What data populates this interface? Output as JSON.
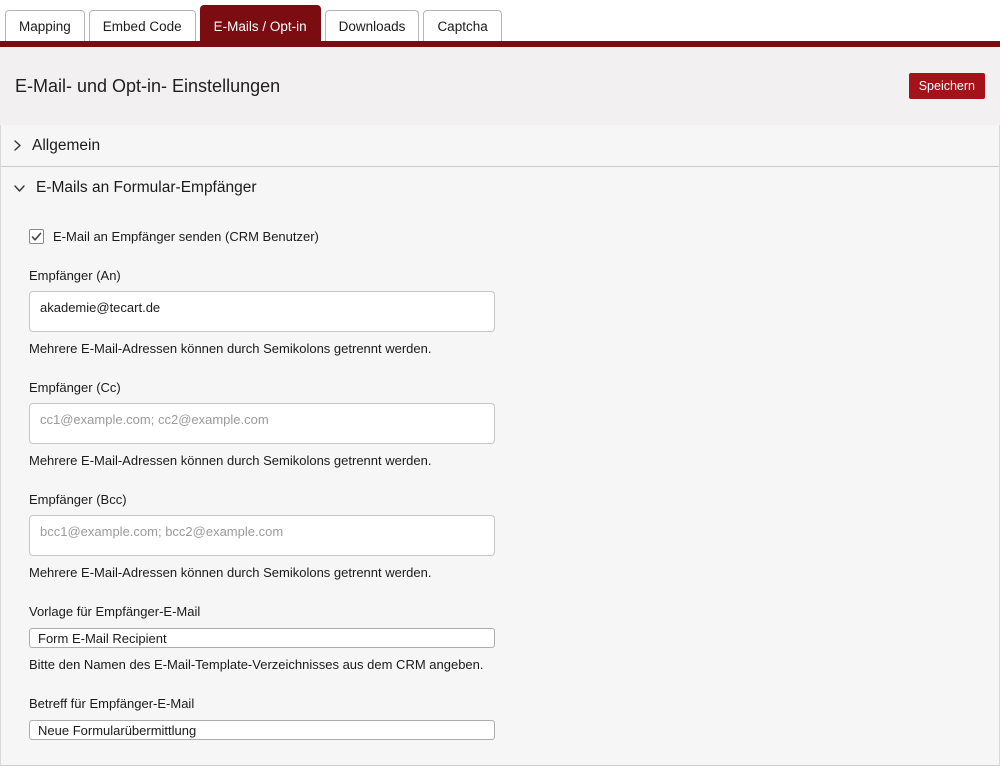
{
  "colors": {
    "accent_maroon": "#7b0d12",
    "save_button_red": "#a5131a",
    "header_band_bg": "#f2f0f0",
    "panel_bg": "#f7f6f6"
  },
  "tabs": [
    {
      "label": "Mapping",
      "active": false
    },
    {
      "label": "Embed Code",
      "active": false
    },
    {
      "label": "E-Mails / Opt-in",
      "active": true
    },
    {
      "label": "Downloads",
      "active": false
    },
    {
      "label": "Captcha",
      "active": false
    }
  ],
  "header": {
    "title": "E-Mail- und Opt-in- Einstellungen",
    "save_label": "Speichern"
  },
  "sections": [
    {
      "label": "Allgemein",
      "state": "collapsed",
      "icon": "chevron-right-icon"
    },
    {
      "label": "E-Mails an Formular-Empfänger",
      "state": "expanded",
      "icon": "chevron-down-icon"
    }
  ],
  "form": {
    "checkbox": {
      "checked": true,
      "label": "E-Mail an Empfänger senden (CRM Benutzer)",
      "icon": "checkmark-icon"
    },
    "fields": [
      {
        "id": "empfaenger-an",
        "label": "Empfänger (An)",
        "value": "akademie@tecart.de",
        "placeholder": "",
        "help": "Mehrere E-Mail-Adressen können durch Semikolons getrennt werden.",
        "size": "large"
      },
      {
        "id": "empfaenger-cc",
        "label": "Empfänger (Cc)",
        "value": "",
        "placeholder": "cc1@example.com; cc2@example.com",
        "help": "Mehrere E-Mail-Adressen können durch Semikolons getrennt werden.",
        "size": "large"
      },
      {
        "id": "empfaenger-bcc",
        "label": "Empfänger (Bcc)",
        "value": "",
        "placeholder": "bcc1@example.com; bcc2@example.com",
        "help": "Mehrere E-Mail-Adressen können durch Semikolons getrennt werden.",
        "size": "large"
      },
      {
        "id": "vorlage-empfaenger-email",
        "label": "Vorlage für Empfänger-E-Mail",
        "value": "Form E-Mail Recipient",
        "placeholder": "",
        "help": "Bitte den Namen des E-Mail-Template-Verzeichnisses aus dem CRM angeben.",
        "size": "small"
      },
      {
        "id": "betreff-empfaenger-email",
        "label": "Betreff für Empfänger-E-Mail",
        "value": "Neue Formularübermittlung",
        "placeholder": "",
        "help": "",
        "size": "small"
      }
    ]
  }
}
